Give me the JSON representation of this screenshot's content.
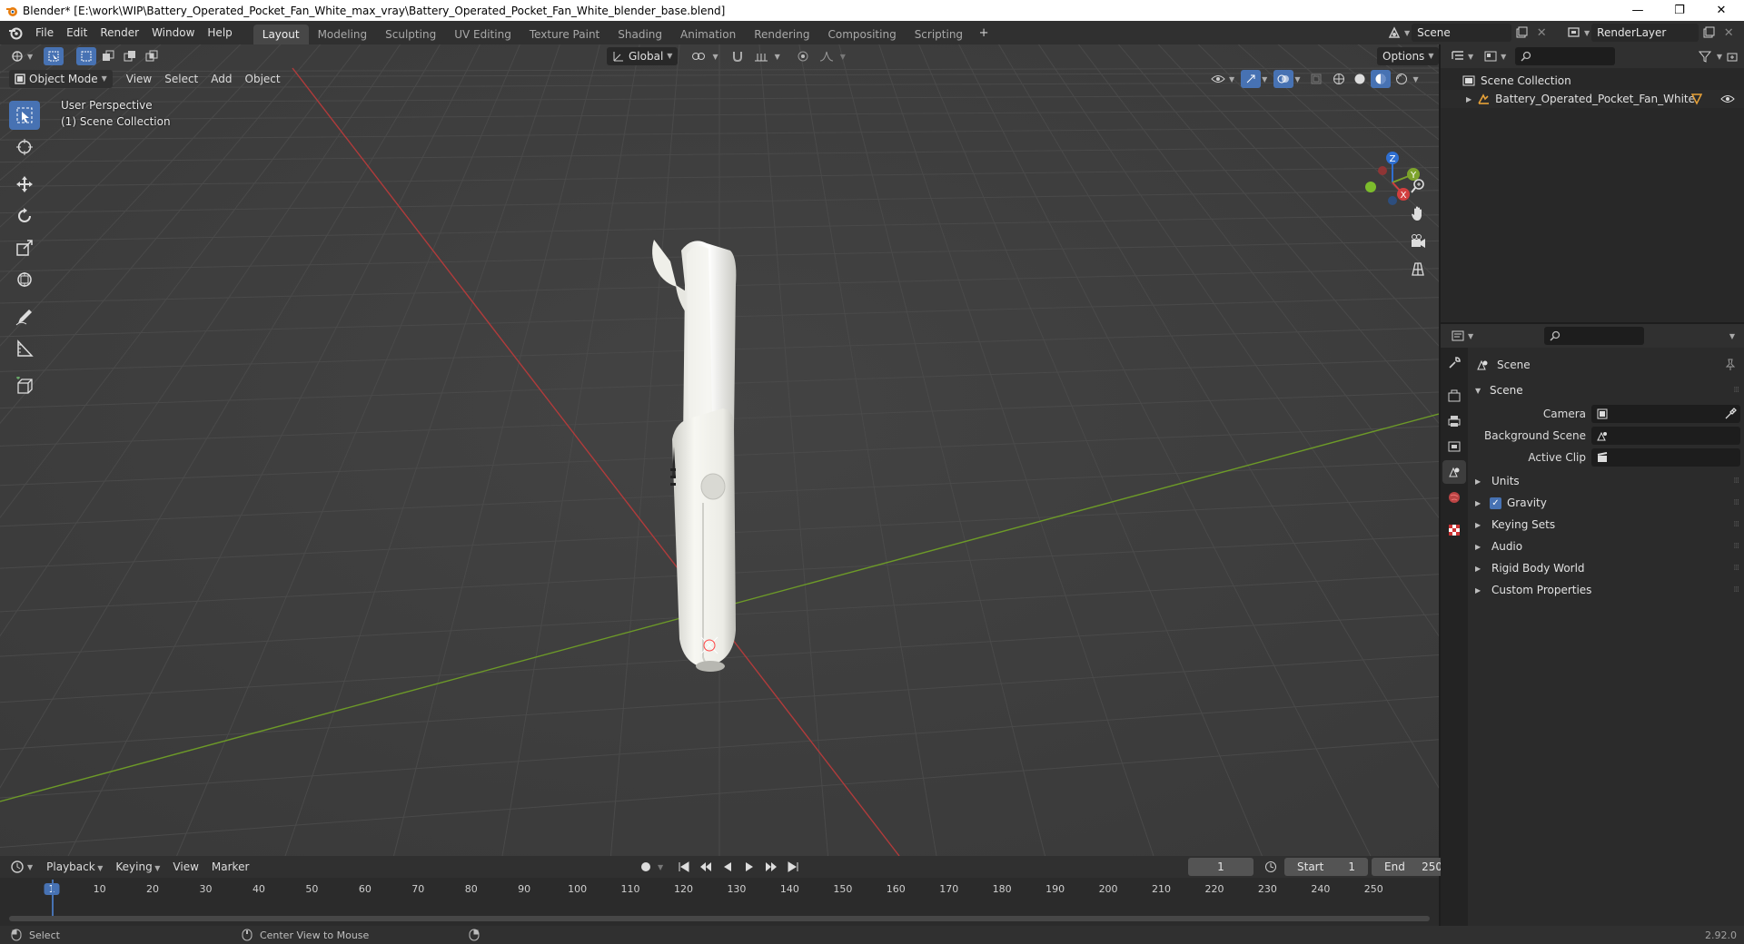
{
  "window": {
    "title": "Blender* [E:\\work\\WIP\\Battery_Operated_Pocket_Fan_White_max_vray\\Battery_Operated_Pocket_Fan_White_blender_base.blend]",
    "minimize": "—",
    "restore": "❐",
    "close": "✕"
  },
  "menu": [
    "File",
    "Edit",
    "Render",
    "Window",
    "Help"
  ],
  "workspaces": [
    "Layout",
    "Modeling",
    "Sculpting",
    "UV Editing",
    "Texture Paint",
    "Shading",
    "Animation",
    "Rendering",
    "Compositing",
    "Scripting"
  ],
  "workspace_add": "+",
  "scene_selector": {
    "value": "Scene"
  },
  "render_layer": {
    "value": "RenderLayer"
  },
  "viewport": {
    "mode": "Object Mode",
    "menus": [
      "View",
      "Select",
      "Add",
      "Object"
    ],
    "orientation": "Global",
    "options_label": "Options",
    "perspective_label": "User Perspective",
    "collection_label": "(1) Scene Collection",
    "gizmo_axes": {
      "z": "Z",
      "y": "Y",
      "x": "X"
    }
  },
  "timeline": {
    "menus": [
      "Playback",
      "Keying",
      "View",
      "Marker"
    ],
    "current_frame": "1",
    "start_label": "Start",
    "start_value": "1",
    "end_label": "End",
    "end_value": "250",
    "ruler": [
      "1",
      "10",
      "20",
      "30",
      "40",
      "50",
      "60",
      "70",
      "80",
      "90",
      "100",
      "110",
      "120",
      "130",
      "140",
      "150",
      "160",
      "170",
      "180",
      "190",
      "200",
      "210",
      "220",
      "230",
      "240",
      "250"
    ]
  },
  "statusbar": {
    "select": "Select",
    "center_view": "Center View to Mouse",
    "version": "2.92.0"
  },
  "outliner": {
    "root": "Scene Collection",
    "items": [
      {
        "label": "Battery_Operated_Pocket_Fan_White"
      }
    ]
  },
  "properties": {
    "context_title": "Scene",
    "panel_scene": "Scene",
    "fields": [
      {
        "label": "Camera",
        "value": ""
      },
      {
        "label": "Background Scene",
        "value": ""
      },
      {
        "label": "Active Clip",
        "value": ""
      }
    ],
    "panels": [
      {
        "label": "Units"
      },
      {
        "label": "Gravity",
        "checked": true
      },
      {
        "label": "Keying Sets"
      },
      {
        "label": "Audio"
      },
      {
        "label": "Rigid Body World"
      },
      {
        "label": "Custom Properties"
      }
    ]
  },
  "colors": {
    "accent": "#4772b3",
    "x_axis": "#d13f3f",
    "y_axis": "#7da32b",
    "z_axis": "#2f6fd1",
    "viewport_bg": "#3d3d3d",
    "panel_bg": "#2b2b2b"
  }
}
